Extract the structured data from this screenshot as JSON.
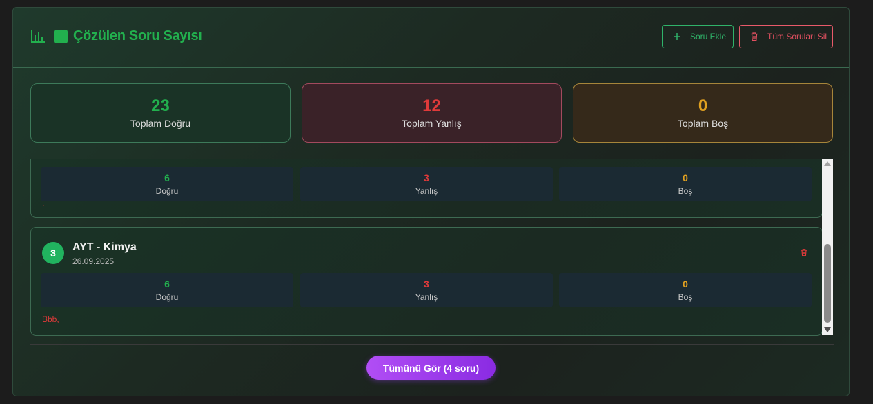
{
  "header": {
    "title": "Çözülen Soru Sayısı",
    "add_label": "Soru Ekle",
    "delete_all_label": "Tüm Soruları Sil"
  },
  "stats": {
    "correct": {
      "value": "23",
      "label": "Toplam Doğru"
    },
    "wrong": {
      "value": "12",
      "label": "Toplam Yanlış"
    },
    "blank": {
      "value": "0",
      "label": "Toplam Boş"
    }
  },
  "entries": [
    {
      "correct": "6",
      "correct_label": "Doğru",
      "wrong": "3",
      "wrong_label": "Yanlış",
      "blank": "0",
      "blank_label": "Boş",
      "note": "."
    },
    {
      "index": "3",
      "title": "AYT - Kimya",
      "date": "26.09.2025",
      "correct": "6",
      "correct_label": "Doğru",
      "wrong": "3",
      "wrong_label": "Yanlış",
      "blank": "0",
      "blank_label": "Boş",
      "note": "Bbb,"
    }
  ],
  "footer": {
    "view_all_label": "Tümünü Gör (4 soru)"
  },
  "colors": {
    "green": "#22b04e",
    "red": "#e03a3a",
    "orange": "#e0a020",
    "purple": "#a644f0"
  }
}
